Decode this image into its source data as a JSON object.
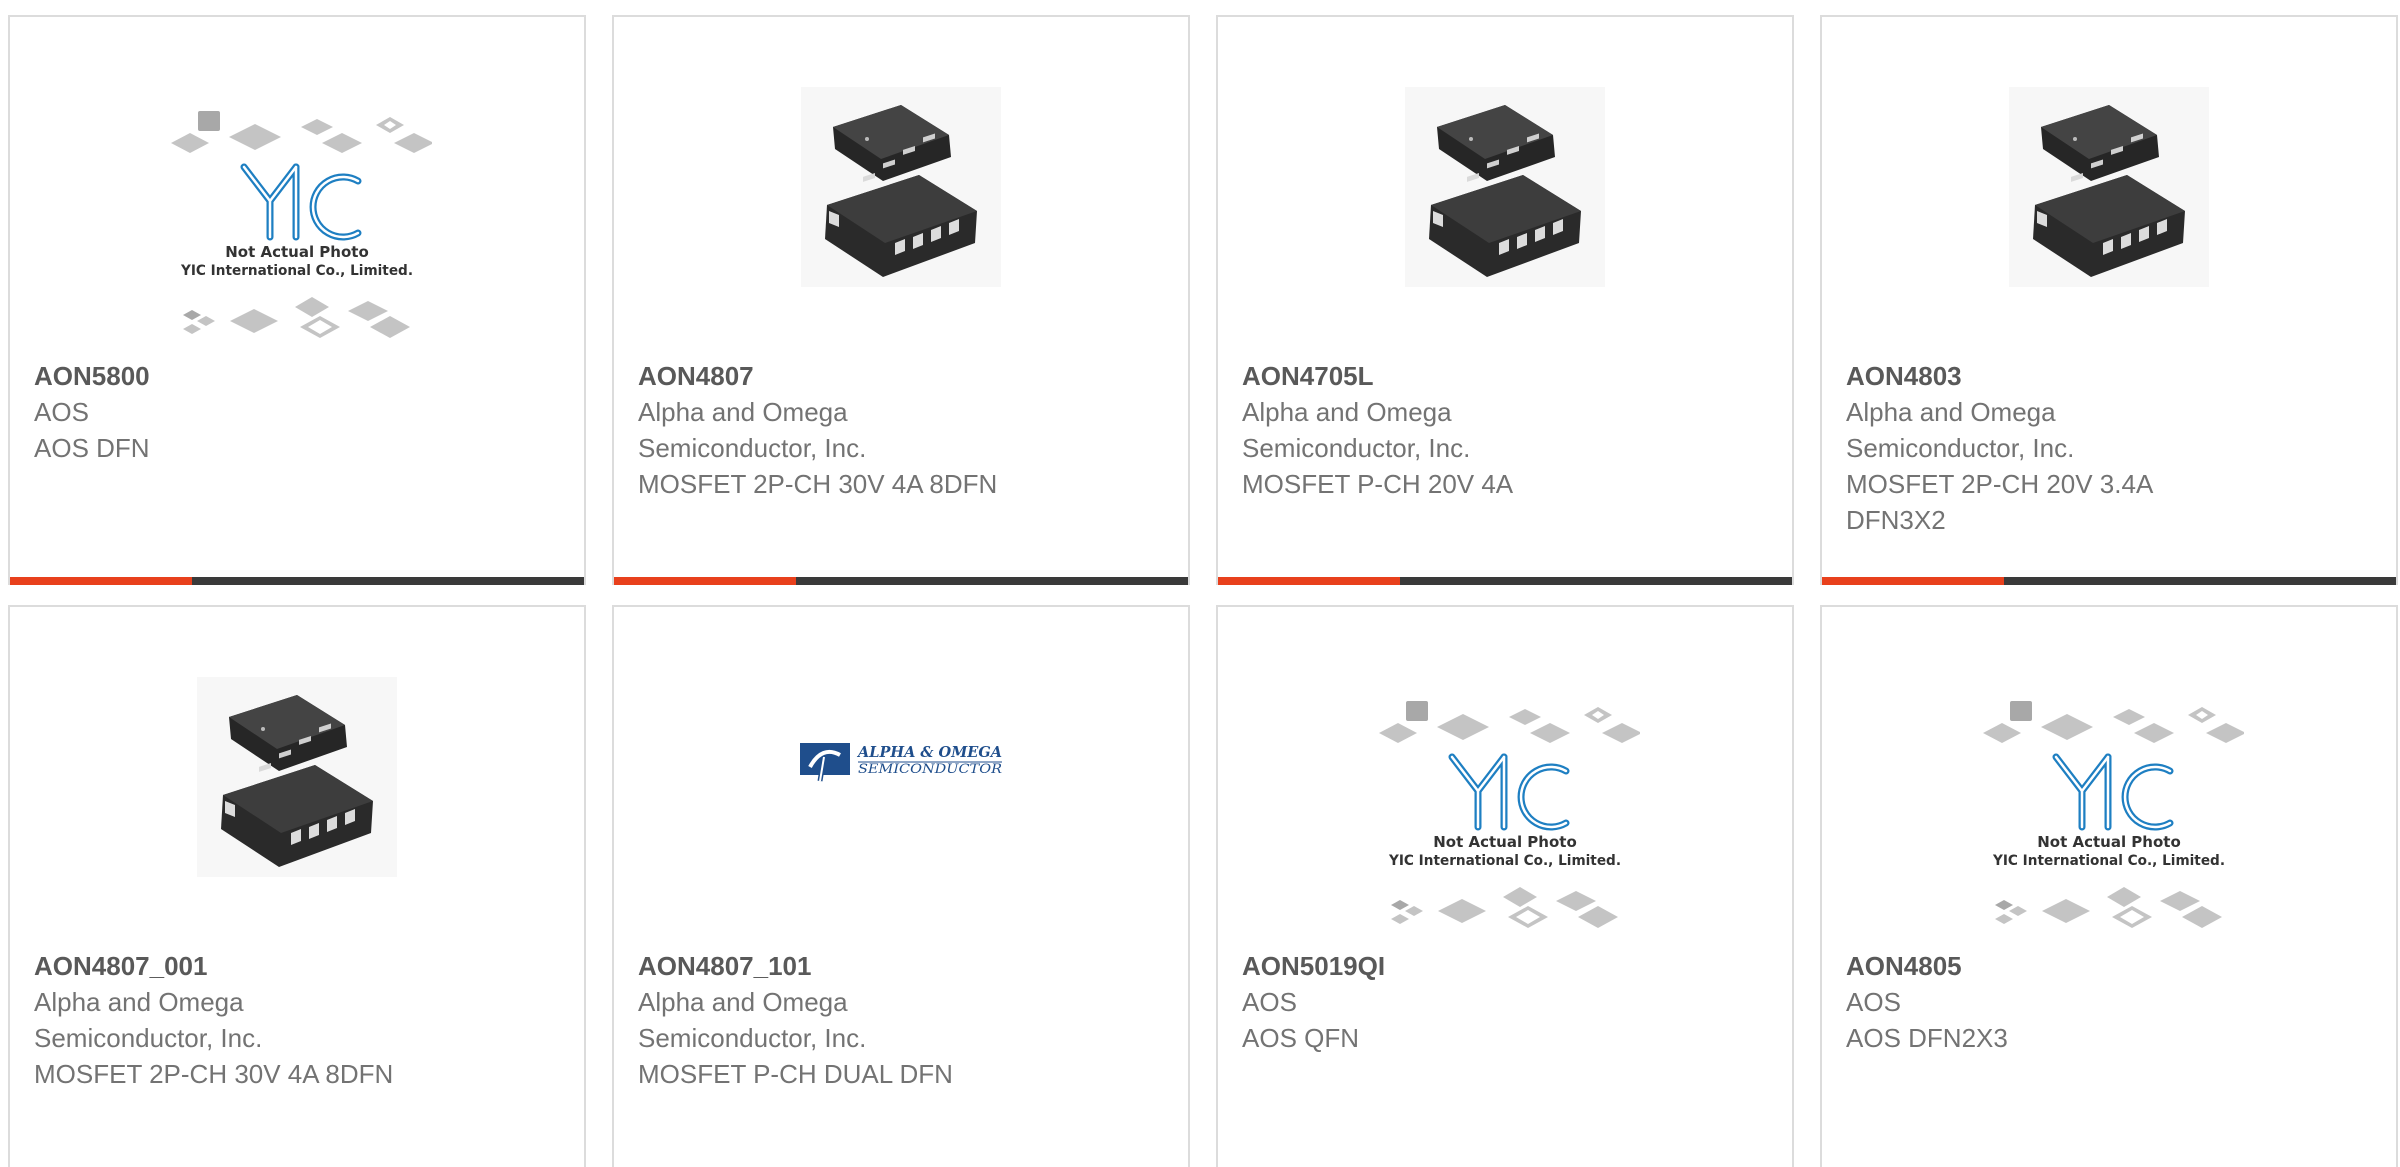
{
  "products": [
    {
      "part": "AON5800",
      "lines": [
        "AOS",
        "AOS DFN"
      ],
      "image": "yic-placeholder"
    },
    {
      "part": "AON4807",
      "lines": [
        "Alpha and Omega",
        "Semiconductor, Inc.",
        "MOSFET 2P-CH 30V 4A 8DFN"
      ],
      "image": "dfn-chip"
    },
    {
      "part": "AON4705L",
      "lines": [
        "Alpha and Omega",
        "Semiconductor, Inc.",
        "MOSFET P-CH 20V 4A"
      ],
      "image": "dfn-chip"
    },
    {
      "part": "AON4803",
      "lines": [
        "Alpha and Omega",
        "Semiconductor, Inc.",
        "MOSFET 2P-CH 20V 3.4A",
        "DFN3X2"
      ],
      "image": "dfn-chip"
    },
    {
      "part": "AON4807_001",
      "lines": [
        "Alpha and Omega",
        "Semiconductor, Inc.",
        "MOSFET 2P-CH 30V 4A 8DFN"
      ],
      "image": "dfn-chip"
    },
    {
      "part": "AON4807_101",
      "lines": [
        "Alpha and Omega",
        "Semiconductor, Inc.",
        "MOSFET P-CH DUAL DFN"
      ],
      "image": "aos-logo"
    },
    {
      "part": "AON5019QI",
      "lines": [
        "AOS",
        "AOS QFN"
      ],
      "image": "yic-placeholder"
    },
    {
      "part": "AON4805",
      "lines": [
        "AOS",
        "AOS DFN2X3"
      ],
      "image": "yic-placeholder"
    }
  ],
  "placeholder": {
    "logo": "YIC",
    "line1": "Not Actual Photo",
    "line2": "YIC International Co., Limited."
  },
  "aos_logo": {
    "line1": "ALPHA & OMEGA",
    "line2": "SEMICONDUCTOR"
  },
  "colors": {
    "accent": "#e8401c",
    "bar": "#3a3a3a",
    "border": "#dcdcdc",
    "part_text": "#595959",
    "text": "#737373"
  }
}
